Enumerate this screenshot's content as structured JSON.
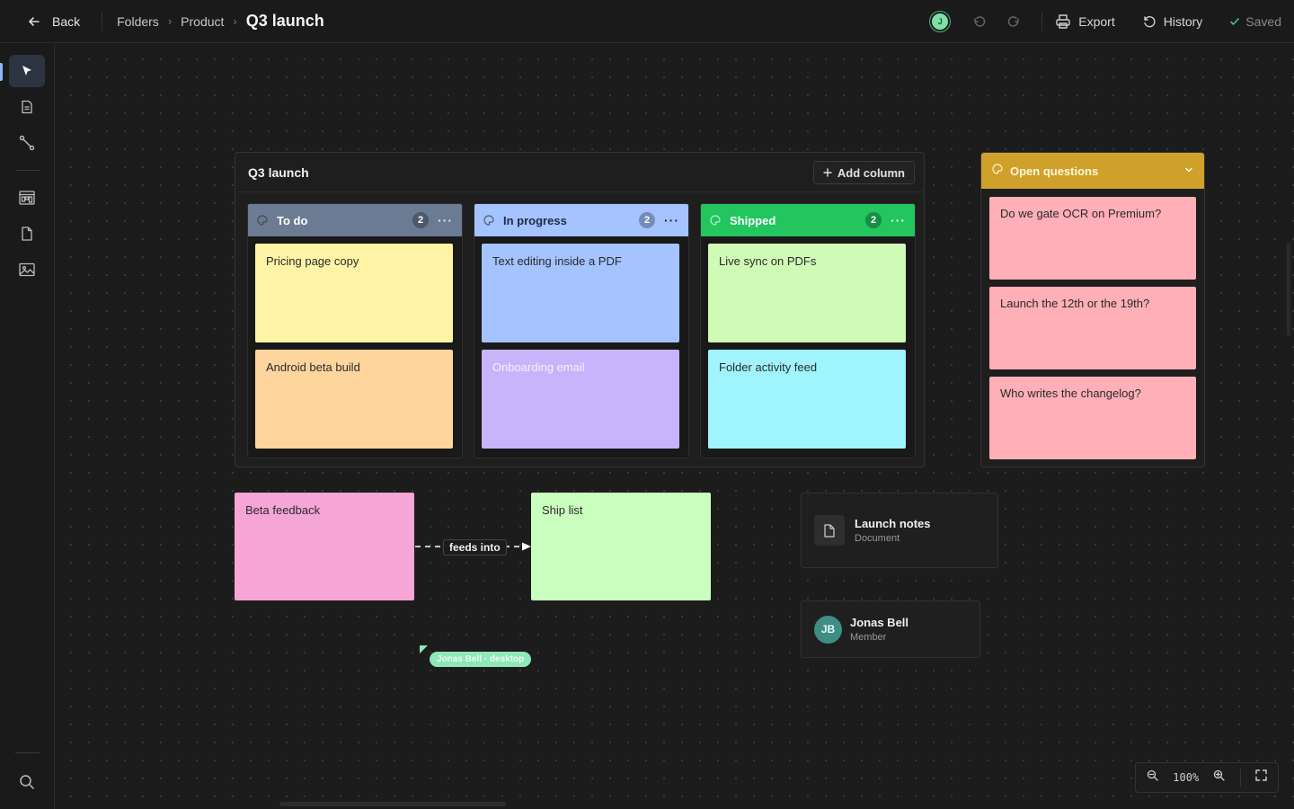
{
  "topbar": {
    "back_label": "Back",
    "breadcrumb": [
      "Folders",
      "Product"
    ],
    "current": "Q3 launch",
    "presence_initial": "J",
    "export_label": "Export",
    "history_label": "History",
    "saved_label": "Saved"
  },
  "rail": {
    "tools": [
      "select-tool",
      "note-tool",
      "connector-tool",
      "board-tool",
      "document-tool",
      "image-tool",
      "search-tool"
    ]
  },
  "board": {
    "title": "Q3 launch",
    "add_column_label": "Add column",
    "columns": [
      {
        "name": "To do",
        "count": "2",
        "color": "#6b7b93",
        "cards": [
          {
            "text": "Pricing page copy",
            "color": "#fff4a6"
          },
          {
            "text": "Android beta build",
            "color": "#ffd59e"
          }
        ]
      },
      {
        "name": "In progress",
        "count": "2",
        "color": "#a4c3ff",
        "cards": [
          {
            "text": "Text editing inside a PDF",
            "color": "#a4c3ff"
          },
          {
            "text": "Onboarding email",
            "color": "#c8b4fb"
          }
        ]
      },
      {
        "name": "Shipped",
        "count": "2",
        "color": "#22c55e",
        "cards": [
          {
            "text": "Live sync on PDFs",
            "color": "#d0fbb6"
          },
          {
            "text": "Folder activity feed",
            "color": "#a0f4fd"
          }
        ]
      }
    ]
  },
  "questions": {
    "title": "Open questions",
    "color": "#cfa12a",
    "cards": [
      "Do we gate OCR on Premium?",
      "Launch the 12th or the 19th?",
      "Who writes the changelog?"
    ]
  },
  "notes": {
    "beta_feedback": "Beta feedback",
    "ship_list": "Ship list",
    "connector_label": "feeds into"
  },
  "doc_card": {
    "title": "Launch notes",
    "subtitle": "Document"
  },
  "member_card": {
    "initials": "JB",
    "name": "Jonas Bell",
    "role": "Member"
  },
  "remote_cursor": {
    "label": "Jonas Bell · desktop"
  },
  "zoom": {
    "value": "100%"
  }
}
